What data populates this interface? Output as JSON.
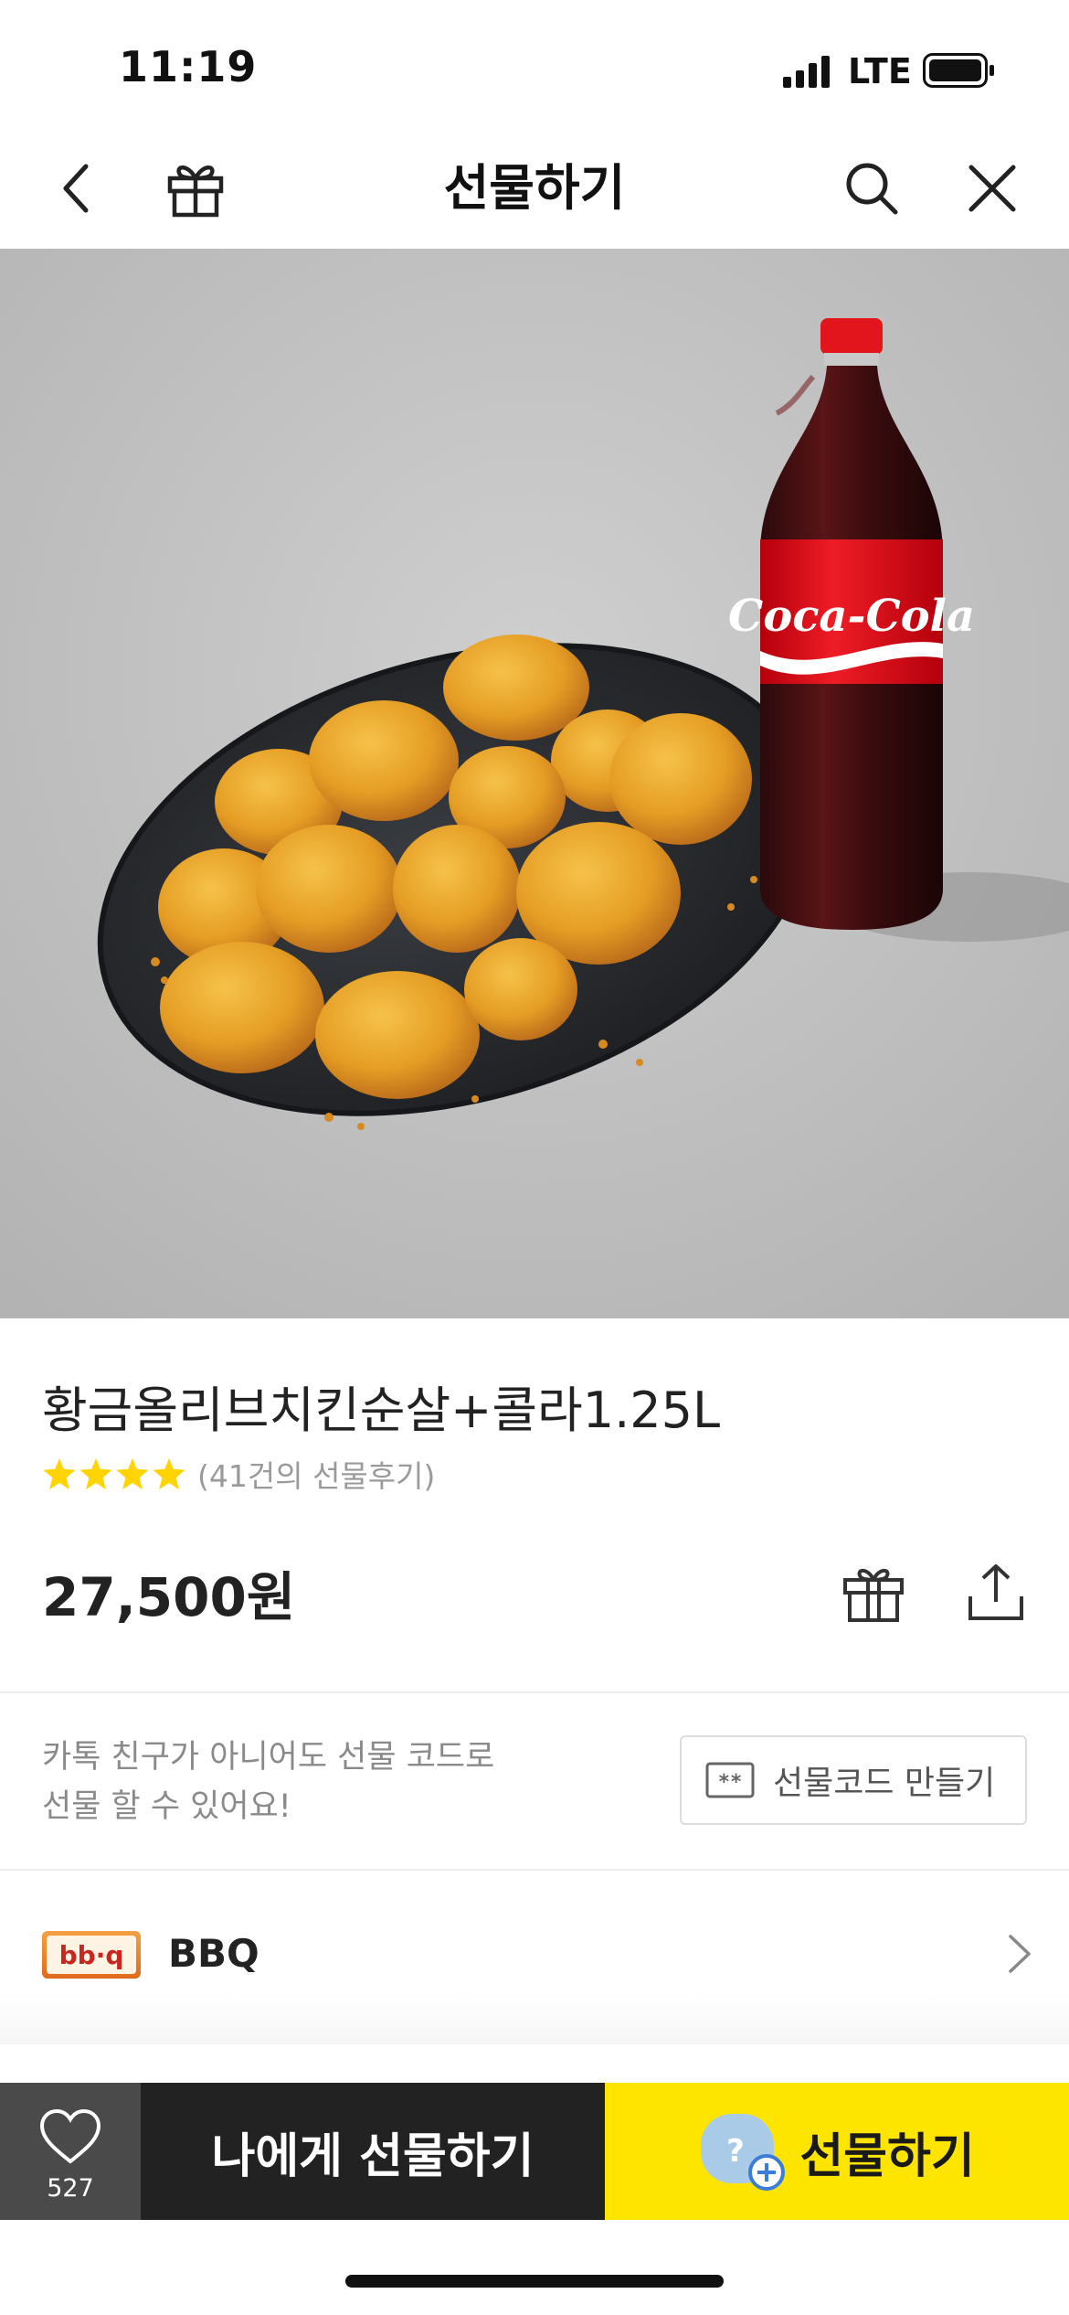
{
  "status_bar": {
    "time": "11:19",
    "network": "LTE"
  },
  "header": {
    "title": "선물하기"
  },
  "product": {
    "name": "황금올리브치킨순살+콜라1.25L",
    "rating_stars": 4,
    "review_count": "(41건의 선물후기)",
    "price": "27,500원"
  },
  "gift_code": {
    "description_line1": "카톡 친구가 아니어도 선물 코드로",
    "description_line2": "선물 할 수 있어요!",
    "button_label": "선물코드 만들기"
  },
  "brand": {
    "logo_text": "bb·q",
    "name": "BBQ"
  },
  "bottom_bar": {
    "like_count": "527",
    "self_gift_label": "나에게 선물하기",
    "gift_label": "선물하기"
  },
  "colors": {
    "accent": "#FEE500",
    "dark": "#222222",
    "like_bg": "#4A4A4A",
    "star": "#FFD400"
  }
}
